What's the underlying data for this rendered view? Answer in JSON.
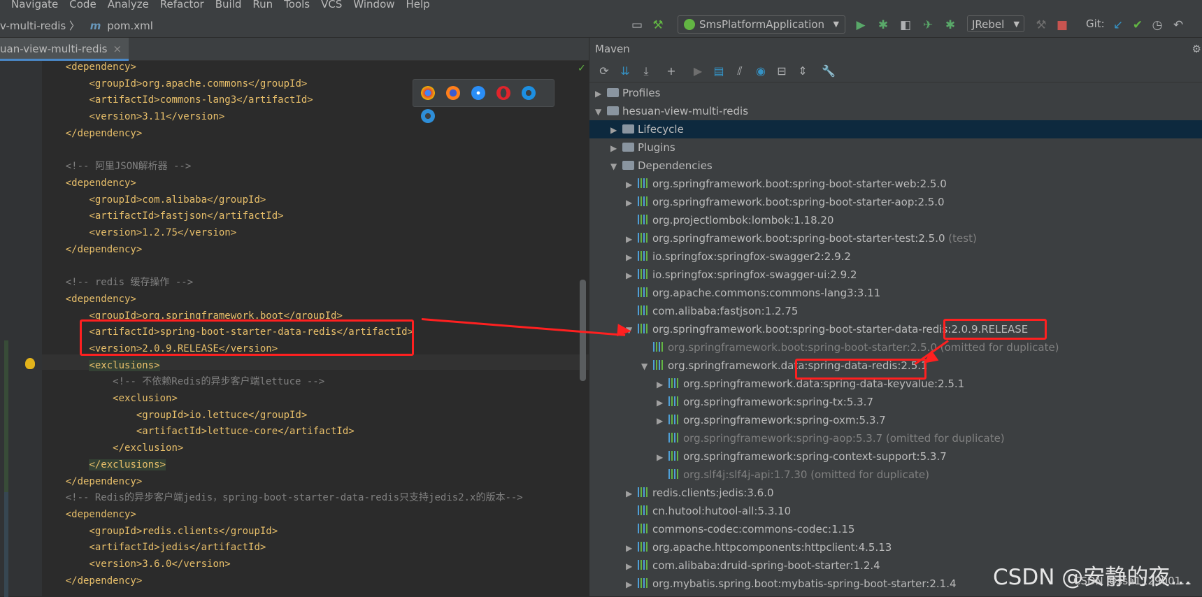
{
  "menu": [
    "Navigate",
    "Code",
    "Analyze",
    "Refactor",
    "Build",
    "Run",
    "Tools",
    "VCS",
    "Window",
    "Help"
  ],
  "breadcrumb": {
    "project": "v-multi-redis",
    "file": "pom.xml",
    "sep": "〉",
    "m_icon": "m"
  },
  "run_config": {
    "label": "SmsPlatformApplication",
    "arrow": "▼"
  },
  "jrebel": {
    "label": "JRebel",
    "arrow": "▼"
  },
  "git_label": "Git:",
  "editor_tab": {
    "label": "uan-view-multi-redis",
    "close": "×"
  },
  "code_lines": [
    {
      "indent": "    ",
      "text": "<dependency>",
      "kind": "tag"
    },
    {
      "indent": "        ",
      "text": "<groupId>org.apache.commons</groupId>",
      "kind": "tag"
    },
    {
      "indent": "        ",
      "text": "<artifactId>commons-lang3</artifactId>",
      "kind": "tag"
    },
    {
      "indent": "        ",
      "text": "<version>3.11</version>",
      "kind": "tag"
    },
    {
      "indent": "    ",
      "text": "</dependency>",
      "kind": "tag"
    },
    {
      "indent": "",
      "text": "",
      "kind": "tx"
    },
    {
      "indent": "    ",
      "text": "<!-- 阿里JSON解析器 -->",
      "kind": "cm"
    },
    {
      "indent": "    ",
      "text": "<dependency>",
      "kind": "tag"
    },
    {
      "indent": "        ",
      "text": "<groupId>com.alibaba</groupId>",
      "kind": "tag"
    },
    {
      "indent": "        ",
      "text": "<artifactId>fastjson</artifactId>",
      "kind": "tag"
    },
    {
      "indent": "        ",
      "text": "<version>1.2.75</version>",
      "kind": "tag"
    },
    {
      "indent": "    ",
      "text": "</dependency>",
      "kind": "tag"
    },
    {
      "indent": "",
      "text": "",
      "kind": "tx"
    },
    {
      "indent": "    ",
      "text": "<!-- redis 缓存操作 -->",
      "kind": "cm"
    },
    {
      "indent": "    ",
      "text": "<dependency>",
      "kind": "tag"
    },
    {
      "indent": "        ",
      "text": "<groupId>org.springframework.boot</groupId>",
      "kind": "tag"
    },
    {
      "indent": "        ",
      "text": "<artifactId>spring-boot-starter-data-redis</artifactId>",
      "kind": "tag"
    },
    {
      "indent": "        ",
      "text": "<version>2.0.9.RELEASE</version>",
      "kind": "tag"
    },
    {
      "indent": "        ",
      "text": "<exclusions>",
      "kind": "tag",
      "hl": true
    },
    {
      "indent": "            ",
      "text": "<!-- 不依赖Redis的异步客户端lettuce -->",
      "kind": "cm"
    },
    {
      "indent": "            ",
      "text": "<exclusion>",
      "kind": "tag"
    },
    {
      "indent": "                ",
      "text": "<groupId>io.lettuce</groupId>",
      "kind": "tag"
    },
    {
      "indent": "                ",
      "text": "<artifactId>lettuce-core</artifactId>",
      "kind": "tag"
    },
    {
      "indent": "            ",
      "text": "</exclusion>",
      "kind": "tag"
    },
    {
      "indent": "        ",
      "text": "</exclusions>",
      "kind": "tag",
      "hl": true
    },
    {
      "indent": "    ",
      "text": "</dependency>",
      "kind": "tag"
    },
    {
      "indent": "    ",
      "text": "<!-- Redis的异步客户端jedis，spring-boot-starter-data-redis只支持jedis2.x的版本-->",
      "kind": "cm"
    },
    {
      "indent": "    ",
      "text": "<dependency>",
      "kind": "tag"
    },
    {
      "indent": "        ",
      "text": "<groupId>redis.clients</groupId>",
      "kind": "tag"
    },
    {
      "indent": "        ",
      "text": "<artifactId>jedis</artifactId>",
      "kind": "tag"
    },
    {
      "indent": "        ",
      "text": "<version>3.6.0</version>",
      "kind": "tag"
    },
    {
      "indent": "    ",
      "text": "</dependency>",
      "kind": "tag"
    }
  ],
  "maven": {
    "title": "Maven",
    "tree": [
      {
        "level": 0,
        "tri": "▶",
        "icon": "folder",
        "label": "Profiles",
        "note": ""
      },
      {
        "level": 0,
        "tri": "▼",
        "icon": "folder",
        "label": "hesuan-view-multi-redis",
        "note": ""
      },
      {
        "level": 1,
        "tri": "▶",
        "icon": "folder",
        "label": "Lifecycle",
        "note": "",
        "sel": true
      },
      {
        "level": 1,
        "tri": "▶",
        "icon": "folder",
        "label": "Plugins",
        "note": ""
      },
      {
        "level": 1,
        "tri": "▼",
        "icon": "folder",
        "label": "Dependencies",
        "note": ""
      },
      {
        "level": 2,
        "tri": "▶",
        "icon": "dep",
        "label": "org.springframework.boot:spring-boot-starter-web:2.5.0",
        "note": ""
      },
      {
        "level": 2,
        "tri": "▶",
        "icon": "dep",
        "label": "org.springframework.boot:spring-boot-starter-aop:2.5.0",
        "note": ""
      },
      {
        "level": 2,
        "tri": "",
        "icon": "dep",
        "label": "org.projectlombok:lombok:1.18.20",
        "note": ""
      },
      {
        "level": 2,
        "tri": "▶",
        "icon": "dep",
        "label": "org.springframework.boot:spring-boot-starter-test:2.5.0",
        "note": " (test)"
      },
      {
        "level": 2,
        "tri": "▶",
        "icon": "dep",
        "label": "io.springfox:springfox-swagger2:2.9.2",
        "note": ""
      },
      {
        "level": 2,
        "tri": "▶",
        "icon": "dep",
        "label": "io.springfox:springfox-swagger-ui:2.9.2",
        "note": ""
      },
      {
        "level": 2,
        "tri": "",
        "icon": "dep",
        "label": "org.apache.commons:commons-lang3:3.11",
        "note": ""
      },
      {
        "level": 2,
        "tri": "",
        "icon": "dep",
        "label": "com.alibaba:fastjson:1.2.75",
        "note": ""
      },
      {
        "level": 2,
        "tri": "▼",
        "icon": "dep",
        "label": "org.springframework.boot:spring-boot-starter-data-redis:2.0.9.RELEASE",
        "note": ""
      },
      {
        "level": 3,
        "tri": "",
        "icon": "dep",
        "label": "org.springframework.boot:spring-boot-starter:2.5.0",
        "note": " (omitted for duplicate)",
        "dim": true
      },
      {
        "level": 3,
        "tri": "▼",
        "icon": "dep",
        "label": "org.springframework.data:spring-data-redis:2.5.1",
        "note": ""
      },
      {
        "level": 4,
        "tri": "▶",
        "icon": "dep",
        "label": "org.springframework.data:spring-data-keyvalue:2.5.1",
        "note": ""
      },
      {
        "level": 4,
        "tri": "▶",
        "icon": "dep",
        "label": "org.springframework:spring-tx:5.3.7",
        "note": ""
      },
      {
        "level": 4,
        "tri": "▶",
        "icon": "dep",
        "label": "org.springframework:spring-oxm:5.3.7",
        "note": ""
      },
      {
        "level": 4,
        "tri": "",
        "icon": "dep",
        "label": "org.springframework:spring-aop:5.3.7",
        "note": " (omitted for duplicate)",
        "dim": true
      },
      {
        "level": 4,
        "tri": "▶",
        "icon": "dep",
        "label": "org.springframework:spring-context-support:5.3.7",
        "note": ""
      },
      {
        "level": 4,
        "tri": "",
        "icon": "dep",
        "label": "org.slf4j:slf4j-api:1.7.30",
        "note": " (omitted for duplicate)",
        "dim": true
      },
      {
        "level": 2,
        "tri": "▶",
        "icon": "dep",
        "label": "redis.clients:jedis:3.6.0",
        "note": ""
      },
      {
        "level": 2,
        "tri": "",
        "icon": "dep",
        "label": "cn.hutool:hutool-all:5.3.10",
        "note": ""
      },
      {
        "level": 2,
        "tri": "",
        "icon": "dep",
        "label": "commons-codec:commons-codec:1.15",
        "note": ""
      },
      {
        "level": 2,
        "tri": "▶",
        "icon": "dep",
        "label": "org.apache.httpcomponents:httpclient:4.5.13",
        "note": ""
      },
      {
        "level": 2,
        "tri": "▶",
        "icon": "dep",
        "label": "com.alibaba:druid-spring-boot-starter:1.2.4",
        "note": ""
      },
      {
        "level": 2,
        "tri": "▶",
        "icon": "dep",
        "label": "org.mybatis.spring.boot:mybatis-spring-boot-starter:2.1.4",
        "note": ""
      }
    ]
  },
  "watermark": "CSDN @安静的夜…",
  "watermark2": "CSDN @ssa1129001…",
  "colors": {
    "annotation": "#ff2020",
    "tag": "#e8bf6a",
    "comment": "#808080",
    "selection": "#0d293e"
  }
}
